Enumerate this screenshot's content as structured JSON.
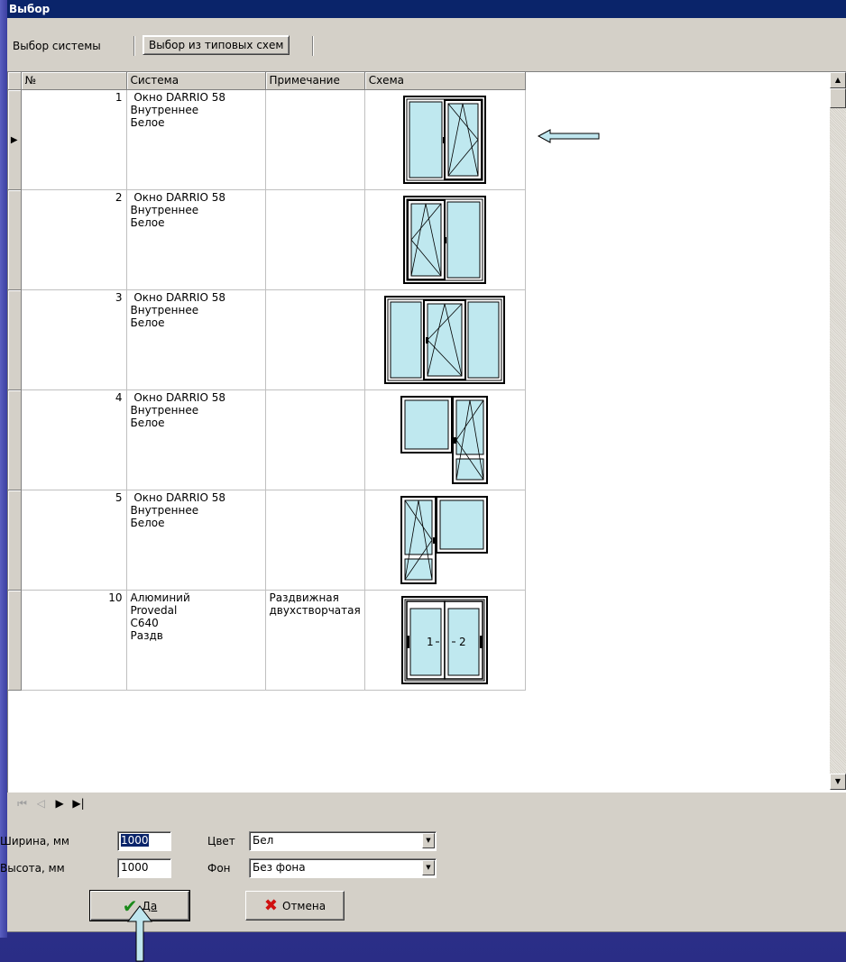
{
  "window": {
    "title": "Выбор"
  },
  "tabs": [
    {
      "label": "Выбор системы"
    },
    {
      "label": "Выбор из типовых схем"
    }
  ],
  "grid": {
    "columns": [
      "№",
      "Система",
      "Примечание",
      "Схема"
    ],
    "rows": [
      {
        "num": "1",
        "system": [
          " Окно DARRIO 58",
          "Внутреннее",
          "Белое"
        ],
        "note": "",
        "scheme": "window-2pane-right-tilt-icon"
      },
      {
        "num": "2",
        "system": [
          " Окно DARRIO 58",
          "Внутреннее",
          "Белое"
        ],
        "note": "",
        "scheme": "window-2pane-left-tilt-icon"
      },
      {
        "num": "3",
        "system": [
          " Окно DARRIO 58",
          "Внутреннее",
          "Белое"
        ],
        "note": "",
        "scheme": "window-3pane-middle-tilt-icon"
      },
      {
        "num": "4",
        "system": [
          " Окно DARRIO 58",
          "Внутреннее",
          "Белое"
        ],
        "note": "",
        "scheme": "balcony-door-right-icon"
      },
      {
        "num": "5",
        "system": [
          " Окно DARRIO 58",
          "Внутреннее",
          "Белое"
        ],
        "note": "",
        "scheme": "balcony-door-left-icon"
      },
      {
        "num": "10",
        "system": [
          "Алюминий",
          "Provedal",
          "C640",
          "Раздв"
        ],
        "note": [
          "Раздвижная",
          "двухстворчатая"
        ],
        "scheme": "sliding-2pane-icon"
      }
    ]
  },
  "navigator": {
    "first": "⏮",
    "prior": "◁",
    "next": "▶",
    "last": "▶|"
  },
  "form": {
    "width_label": "Ширина, мм",
    "width_value": "1000",
    "height_label": "Высота, мм",
    "height_value": "1000",
    "color_label": "Цвет",
    "color_value": "Бел",
    "bg_label": "Фон",
    "bg_value": "Без фона"
  },
  "buttons": {
    "ok_label": "Да",
    "cancel_label": "Отмена"
  },
  "sliding_labels": [
    "1",
    "2"
  ],
  "colors": {
    "glass": "#bfe8ef",
    "titlebar": "#0a246a",
    "arrow": "#bfe6ee"
  }
}
